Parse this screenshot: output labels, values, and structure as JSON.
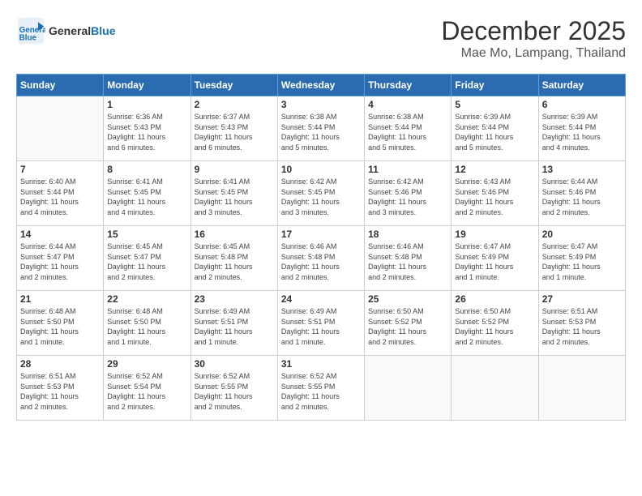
{
  "header": {
    "logo_line1": "General",
    "logo_line2": "Blue",
    "month_title": "December 2025",
    "location": "Mae Mo, Lampang, Thailand"
  },
  "days_of_week": [
    "Sunday",
    "Monday",
    "Tuesday",
    "Wednesday",
    "Thursday",
    "Friday",
    "Saturday"
  ],
  "weeks": [
    [
      {
        "day": "",
        "info": ""
      },
      {
        "day": "1",
        "info": "Sunrise: 6:36 AM\nSunset: 5:43 PM\nDaylight: 11 hours\nand 6 minutes."
      },
      {
        "day": "2",
        "info": "Sunrise: 6:37 AM\nSunset: 5:43 PM\nDaylight: 11 hours\nand 6 minutes."
      },
      {
        "day": "3",
        "info": "Sunrise: 6:38 AM\nSunset: 5:44 PM\nDaylight: 11 hours\nand 5 minutes."
      },
      {
        "day": "4",
        "info": "Sunrise: 6:38 AM\nSunset: 5:44 PM\nDaylight: 11 hours\nand 5 minutes."
      },
      {
        "day": "5",
        "info": "Sunrise: 6:39 AM\nSunset: 5:44 PM\nDaylight: 11 hours\nand 5 minutes."
      },
      {
        "day": "6",
        "info": "Sunrise: 6:39 AM\nSunset: 5:44 PM\nDaylight: 11 hours\nand 4 minutes."
      }
    ],
    [
      {
        "day": "7",
        "info": "Sunrise: 6:40 AM\nSunset: 5:44 PM\nDaylight: 11 hours\nand 4 minutes."
      },
      {
        "day": "8",
        "info": "Sunrise: 6:41 AM\nSunset: 5:45 PM\nDaylight: 11 hours\nand 4 minutes."
      },
      {
        "day": "9",
        "info": "Sunrise: 6:41 AM\nSunset: 5:45 PM\nDaylight: 11 hours\nand 3 minutes."
      },
      {
        "day": "10",
        "info": "Sunrise: 6:42 AM\nSunset: 5:45 PM\nDaylight: 11 hours\nand 3 minutes."
      },
      {
        "day": "11",
        "info": "Sunrise: 6:42 AM\nSunset: 5:46 PM\nDaylight: 11 hours\nand 3 minutes."
      },
      {
        "day": "12",
        "info": "Sunrise: 6:43 AM\nSunset: 5:46 PM\nDaylight: 11 hours\nand 2 minutes."
      },
      {
        "day": "13",
        "info": "Sunrise: 6:44 AM\nSunset: 5:46 PM\nDaylight: 11 hours\nand 2 minutes."
      }
    ],
    [
      {
        "day": "14",
        "info": "Sunrise: 6:44 AM\nSunset: 5:47 PM\nDaylight: 11 hours\nand 2 minutes."
      },
      {
        "day": "15",
        "info": "Sunrise: 6:45 AM\nSunset: 5:47 PM\nDaylight: 11 hours\nand 2 minutes."
      },
      {
        "day": "16",
        "info": "Sunrise: 6:45 AM\nSunset: 5:48 PM\nDaylight: 11 hours\nand 2 minutes."
      },
      {
        "day": "17",
        "info": "Sunrise: 6:46 AM\nSunset: 5:48 PM\nDaylight: 11 hours\nand 2 minutes."
      },
      {
        "day": "18",
        "info": "Sunrise: 6:46 AM\nSunset: 5:48 PM\nDaylight: 11 hours\nand 2 minutes."
      },
      {
        "day": "19",
        "info": "Sunrise: 6:47 AM\nSunset: 5:49 PM\nDaylight: 11 hours\nand 1 minute."
      },
      {
        "day": "20",
        "info": "Sunrise: 6:47 AM\nSunset: 5:49 PM\nDaylight: 11 hours\nand 1 minute."
      }
    ],
    [
      {
        "day": "21",
        "info": "Sunrise: 6:48 AM\nSunset: 5:50 PM\nDaylight: 11 hours\nand 1 minute."
      },
      {
        "day": "22",
        "info": "Sunrise: 6:48 AM\nSunset: 5:50 PM\nDaylight: 11 hours\nand 1 minute."
      },
      {
        "day": "23",
        "info": "Sunrise: 6:49 AM\nSunset: 5:51 PM\nDaylight: 11 hours\nand 1 minute."
      },
      {
        "day": "24",
        "info": "Sunrise: 6:49 AM\nSunset: 5:51 PM\nDaylight: 11 hours\nand 1 minute."
      },
      {
        "day": "25",
        "info": "Sunrise: 6:50 AM\nSunset: 5:52 PM\nDaylight: 11 hours\nand 2 minutes."
      },
      {
        "day": "26",
        "info": "Sunrise: 6:50 AM\nSunset: 5:52 PM\nDaylight: 11 hours\nand 2 minutes."
      },
      {
        "day": "27",
        "info": "Sunrise: 6:51 AM\nSunset: 5:53 PM\nDaylight: 11 hours\nand 2 minutes."
      }
    ],
    [
      {
        "day": "28",
        "info": "Sunrise: 6:51 AM\nSunset: 5:53 PM\nDaylight: 11 hours\nand 2 minutes."
      },
      {
        "day": "29",
        "info": "Sunrise: 6:52 AM\nSunset: 5:54 PM\nDaylight: 11 hours\nand 2 minutes."
      },
      {
        "day": "30",
        "info": "Sunrise: 6:52 AM\nSunset: 5:55 PM\nDaylight: 11 hours\nand 2 minutes."
      },
      {
        "day": "31",
        "info": "Sunrise: 6:52 AM\nSunset: 5:55 PM\nDaylight: 11 hours\nand 2 minutes."
      },
      {
        "day": "",
        "info": ""
      },
      {
        "day": "",
        "info": ""
      },
      {
        "day": "",
        "info": ""
      }
    ]
  ]
}
